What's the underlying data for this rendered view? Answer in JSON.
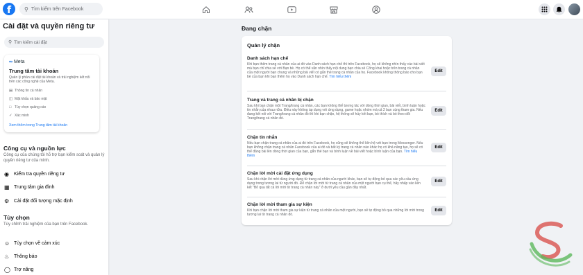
{
  "topbar": {
    "logo": "f",
    "search_placeholder": "Tìm kiếm trên Facebook",
    "nav_icons": [
      "home-icon",
      "friends-icon",
      "watch-icon",
      "marketplace-icon",
      "groups-icon"
    ],
    "right_icons": [
      "menu-grid-icon",
      "notifications-icon"
    ]
  },
  "sidebar": {
    "title": "Cài đặt và quyền riêng tư",
    "search_placeholder": "Tìm kiếm cài đặt",
    "meta_card": {
      "logo": "Meta",
      "title": "Trung tâm tài khoản",
      "description": "Quản lý phần cài đặt tài khoản và trải nghiệm kết nối trên các công nghệ của Meta.",
      "items": [
        "Thông tin cá nhân",
        "Mật khẩu và bảo mật",
        "Tùy chọn quảng cáo",
        "Xác minh"
      ],
      "link": "Xem thêm trong Trung tâm tài khoản"
    },
    "tools": {
      "title": "Công cụ và nguồn lực",
      "description": "Công cụ của chúng tôi hỗ trợ bạn kiểm soát và quản lý quyền riêng tư của mình.",
      "items": [
        "Kiểm tra quyền riêng tư",
        "Trung tâm gia đình",
        "Cài đặt đối tượng mặc định"
      ]
    },
    "preferences": {
      "title": "Tùy chọn",
      "description": "Tùy chỉnh trải nghiệm của bạn trên Facebook.",
      "items": [
        "Tùy chọn về cảm xúc",
        "Thông báo",
        "Trợ năng"
      ]
    }
  },
  "main": {
    "title": "Đang chặn",
    "panel_title": "Quản lý chặn",
    "edit_label": "Edit",
    "blocks": [
      {
        "title": "Danh sách hạn chế",
        "description": "Khi bạn thêm trang cá nhân của ai đó vào Danh sách hạn chế thì trên Facebook, họ sẽ không nhìn thấy các bài viết mà bạn chỉ chia sẻ với Bạn bè. Họ có thể vẫn nhìn thấy nội dung bạn chia sẻ Công khai hoặc trên trang cá nhân của một người bạn chung và những bài viết có gắn thẻ trang cá nhân của họ. Facebook không thông báo cho bạn bè của bạn khi bạn thêm họ vào Danh sách hạn chế.",
        "more": "Tìm hiểu thêm"
      },
      {
        "title": "Trang và trang cá nhân bị chặn",
        "description": "Sau khi bạn chặn một Trang/trang cá nhân, các bạn không thể tương tác với dòng thời gian, bài viết, bình luận hoặc tin nhắn của nhau nữa. Điều này không áp dụng với ứng dụng, game hoặc nhóm mà cả 2 bạn cùng tham gia. Nếu đang kết nối với Trang/trang cá nhân đó thì khi bạn chặn, hệ thống sẽ hủy kết bạn, bỏ thích và bỏ theo dõi Trang/trang cá nhân đó.",
        "more": ""
      },
      {
        "title": "Chặn tin nhắn",
        "description": "Nếu bạn chặn trang cá nhân của ai đó trên Facebook, họ cũng sẽ không thể liên hệ với bạn trong Messenger. Nếu bạn không chặn trang cá nhân Facebook của ai đó và bất kỳ trang cá nhân nào khác họ có khả năng tạo, họ sẽ có thể đăng bài lên dòng thời gian của bạn, gắn thẻ bạn và bình luận về bài viết hoặc bình luận của bạn.",
        "more": "Tìm hiểu thêm"
      },
      {
        "title": "Chặn lời mời cài đặt ứng dụng",
        "description": "Sau khi chặn lời mời dùng ứng dụng từ trang cá nhân của người khác, bạn sẽ tự động bỏ qua các yêu cầu ứng dụng trong tương lai từ người đó. Để chặn lời mời từ trang cá nhân của một người bạn cụ thể, hãy nhấp vào liên kết \"Bỏ qua tất cả lời mời từ trang cá nhân này\" ở dưới yêu cầu gần đây nhất.",
        "more": ""
      },
      {
        "title": "Chặn lời mời tham gia sự kiện",
        "description": "Khi bạn chặn lời mời tham gia sự kiện từ trang cá nhân của một người, bạn sẽ tự động bỏ qua những lời mời trong tương lai từ trang cá nhân đó.",
        "more": ""
      }
    ]
  },
  "watermark": "watermark-logo"
}
